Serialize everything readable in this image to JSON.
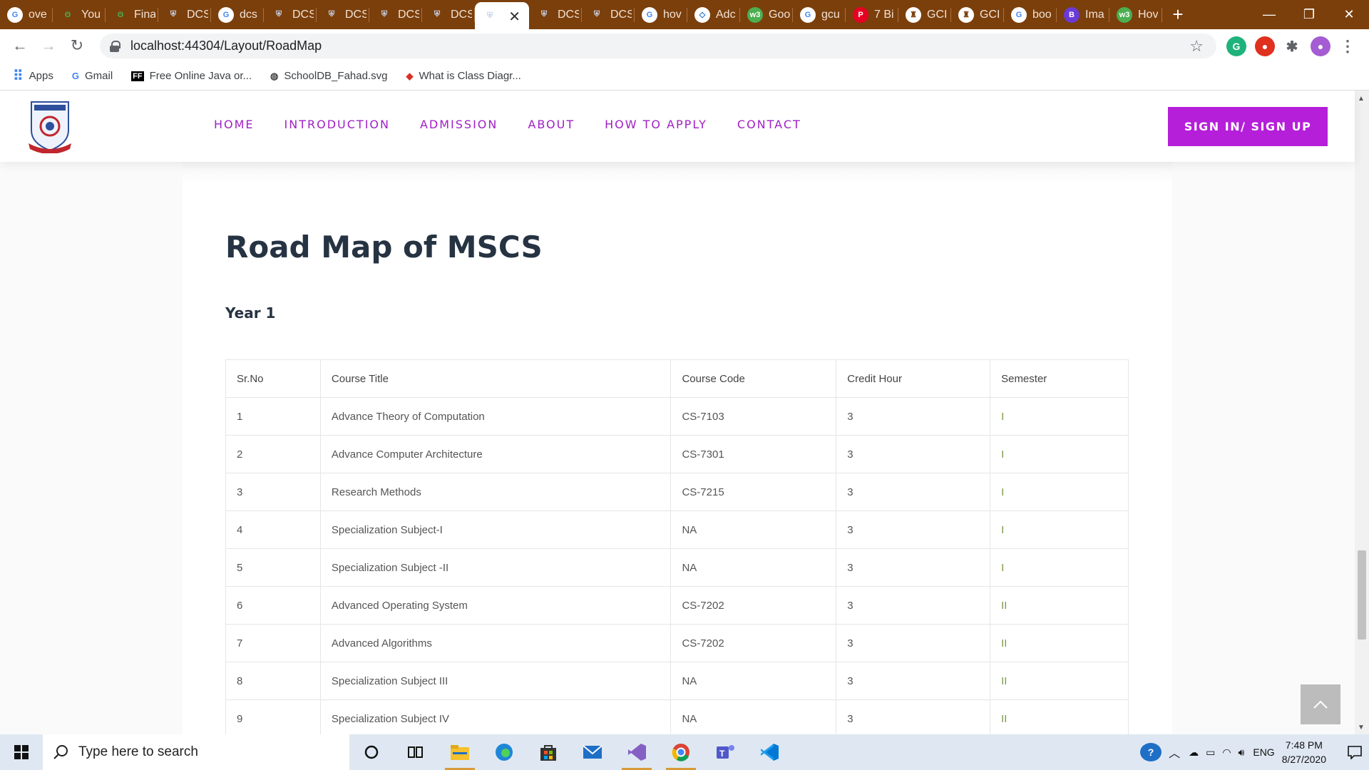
{
  "browser": {
    "tabs": [
      {
        "title": "ove",
        "icon": "google-icon",
        "color": "#ffffff"
      },
      {
        "title": "You",
        "icon": "leaf-icon",
        "color": "#4caf50"
      },
      {
        "title": "Fina",
        "icon": "leaf-icon",
        "color": "#4caf50"
      },
      {
        "title": "DCS",
        "icon": "shield-icon",
        "color": "#c8d4ea"
      },
      {
        "title": "dcs",
        "icon": "google-icon",
        "color": "#ffffff"
      },
      {
        "title": "DCS",
        "icon": "shield-icon",
        "color": "#c8d4ea"
      },
      {
        "title": "DCS",
        "icon": "shield-icon",
        "color": "#c8d4ea"
      },
      {
        "title": "DCS",
        "icon": "shield-icon",
        "color": "#c8d4ea"
      },
      {
        "title": "DCS",
        "icon": "shield-icon",
        "color": "#c8d4ea"
      },
      {
        "title": "",
        "icon": "shield-icon",
        "color": "#c8d4ea",
        "active": true
      },
      {
        "title": "DCS",
        "icon": "shield-icon",
        "color": "#c8d4ea"
      },
      {
        "title": "DCS",
        "icon": "shield-icon",
        "color": "#c8d4ea"
      },
      {
        "title": "hov",
        "icon": "google-icon",
        "color": "#ffffff"
      },
      {
        "title": "Adc",
        "icon": "code-icon",
        "color": "#ffffff"
      },
      {
        "title": "Goo",
        "icon": "w3-icon",
        "color": "#4caf50"
      },
      {
        "title": "gcu",
        "icon": "google-icon",
        "color": "#ffffff"
      },
      {
        "title": "7 Bi",
        "icon": "pinterest-icon",
        "color": "#e60023"
      },
      {
        "title": "GCI",
        "icon": "crest-icon",
        "color": "#ffffff"
      },
      {
        "title": "GCI",
        "icon": "crest-icon",
        "color": "#ffffff"
      },
      {
        "title": "boo",
        "icon": "google-icon",
        "color": "#ffffff"
      },
      {
        "title": "Ima",
        "icon": "b-icon",
        "color": "#6a3ad6"
      },
      {
        "title": "Hov",
        "icon": "w3-icon",
        "color": "#4caf50"
      }
    ],
    "new_tab": "+",
    "close_tab": "✕",
    "window_controls": {
      "minimize": "—",
      "restore": "❐",
      "close": "✕"
    },
    "url": "localhost:44304/Layout/RoadMap",
    "bookmarks": [
      {
        "label": "Apps",
        "icon": "apps-grid-icon"
      },
      {
        "label": "Gmail",
        "icon": "google-icon"
      },
      {
        "label": "Free Online Java or...",
        "icon": "ff-icon"
      },
      {
        "label": "SchoolDB_Fahad.svg",
        "icon": "globe-icon"
      },
      {
        "label": "What is Class Diagr...",
        "icon": "diamond-icon"
      }
    ]
  },
  "site": {
    "nav": [
      "HOME",
      "INTRODUCTION",
      "ADMISSION",
      "ABOUT",
      "HOW TO APPLY",
      "CONTACT"
    ],
    "signin": "SIGN IN/ SIGN UP",
    "accent": "#b51fd9",
    "nav_color": "#a020c6"
  },
  "page": {
    "title": "Road Map of MSCS",
    "year": "Year 1",
    "columns": [
      "Sr.No",
      "Course Title",
      "Course Code",
      "Credit Hour",
      "Semester"
    ],
    "rows": [
      [
        "1",
        "Advance Theory of Computation",
        "CS-7103",
        "3",
        "I"
      ],
      [
        "2",
        "Advance Computer Architecture",
        "CS-7301",
        "3",
        "I"
      ],
      [
        "3",
        "Research Methods",
        "CS-7215",
        "3",
        "I"
      ],
      [
        "4",
        "Specialization Subject-I",
        "NA",
        "3",
        "I"
      ],
      [
        "5",
        "Specialization Subject -II",
        "NA",
        "3",
        "I"
      ],
      [
        "6",
        "Advanced Operating System",
        "CS-7202",
        "3",
        "II"
      ],
      [
        "7",
        "Advanced Algorithms",
        "CS-7202",
        "3",
        "II"
      ],
      [
        "8",
        "Specialization Subject III",
        "NA",
        "3",
        "II"
      ],
      [
        "9",
        "Specialization Subject IV",
        "NA",
        "3",
        "II"
      ]
    ]
  },
  "taskbar": {
    "search_placeholder": "Type here to search",
    "lang": "ENG",
    "time": "7:48 PM",
    "date": "8/27/2020"
  }
}
